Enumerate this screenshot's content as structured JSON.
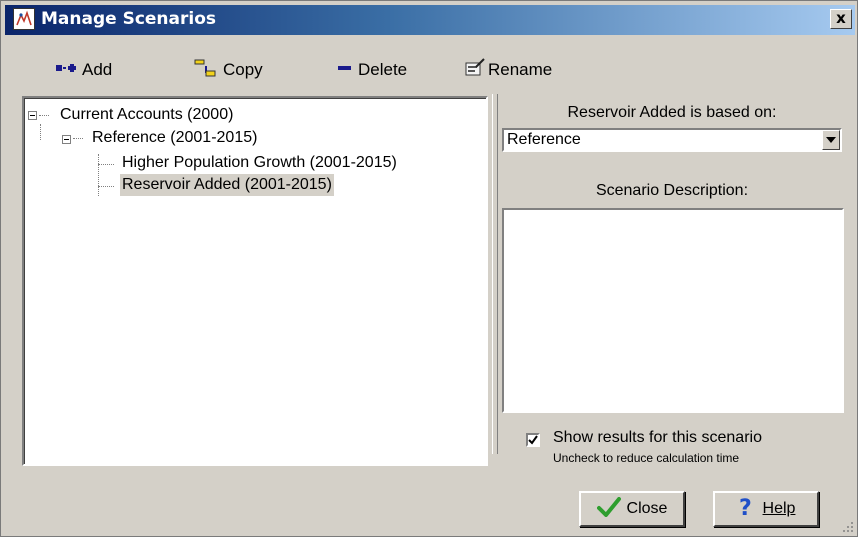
{
  "window": {
    "title": "Manage Scenarios",
    "close_glyph": "x"
  },
  "toolbar": {
    "add_label": "Add",
    "copy_label": "Copy",
    "delete_label": "Delete",
    "rename_label": "Rename"
  },
  "tree": {
    "items": [
      {
        "label": "Current Accounts (2000)",
        "level": 0,
        "expanded": true
      },
      {
        "label": "Reference (2001-2015)",
        "level": 1,
        "expanded": true
      },
      {
        "label": "Higher Population Growth (2001-2015)",
        "level": 2
      },
      {
        "label": "Reservoir Added (2001-2015)",
        "level": 2,
        "selected": true
      }
    ]
  },
  "right": {
    "based_on_label": "Reservoir Added is based on:",
    "based_on_value": "Reference",
    "description_label": "Scenario Description:",
    "description_text": "",
    "show_results_checked": true,
    "show_results_label": "Show results for this scenario",
    "show_results_hint": "Uncheck to reduce calculation time"
  },
  "buttons": {
    "close_label": "Close",
    "help_label": "Help"
  },
  "colors": {
    "title_bar_start": "#0a246a",
    "title_bar_end": "#a6caf0",
    "dialog_face": "#d4d0c8",
    "selection": "#d4d0c8",
    "check_green": "#2e9e2e",
    "help_blue": "#1f4fc8"
  },
  "icons": {
    "app": "app-icon",
    "add": "add-icon",
    "copy": "copy-icon",
    "delete": "delete-icon",
    "rename": "rename-icon",
    "close": "checkmark-icon",
    "help": "question-icon"
  }
}
